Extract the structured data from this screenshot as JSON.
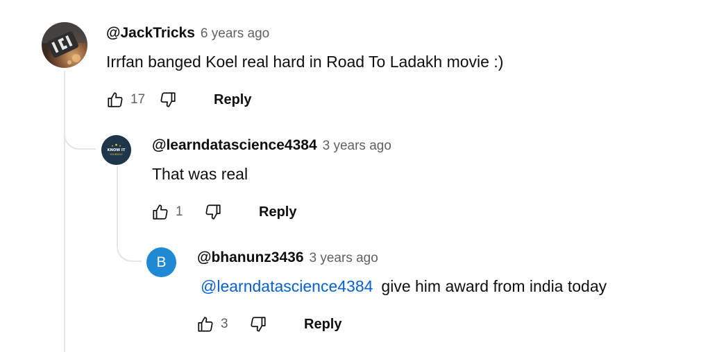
{
  "colors": {
    "mention": "#065fd4",
    "secondary_text": "#606060",
    "thread_line": "#e5e5e5",
    "avatar_b_bg": "#1f8ad3"
  },
  "comments": [
    {
      "author": "@JackTricks",
      "time": "6 years ago",
      "text": "Irrfan banged Koel real hard in Road To Ladakh movie :)",
      "likes": "17",
      "reply_label": "Reply",
      "avatar": {
        "type": "photo",
        "icon": "profile-photo"
      }
    },
    {
      "author": "@learndatascience4384",
      "time": "3 years ago",
      "text": "That was real",
      "likes": "1",
      "reply_label": "Reply",
      "avatar": {
        "type": "logo",
        "line1": "KNOW IT",
        "line2": "YOURSELF"
      }
    },
    {
      "author": "@bhanunz3436",
      "time": "3 years ago",
      "mention": "@learndatascience4384",
      "text": "give him award from india today",
      "likes": "3",
      "reply_label": "Reply",
      "avatar": {
        "type": "letter",
        "letter": "B"
      }
    }
  ]
}
